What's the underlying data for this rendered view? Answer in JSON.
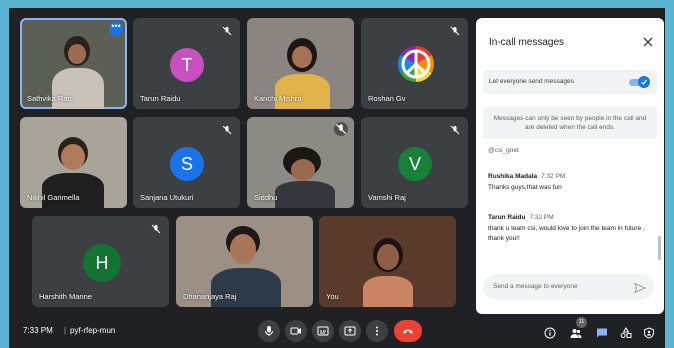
{
  "participants": [
    {
      "name": "Sathvika Rao",
      "type": "video"
    },
    {
      "name": "Tarun Raidu",
      "type": "avatar",
      "initial": "T",
      "color": "#c850c0"
    },
    {
      "name": "Kanchi Mishra",
      "type": "video"
    },
    {
      "name": "Roshan Gv",
      "type": "avatar-image"
    },
    {
      "name": "Nikhil Garimella",
      "type": "video"
    },
    {
      "name": "Sanjana Utukuri",
      "type": "avatar",
      "initial": "S",
      "color": "#1a73e8"
    },
    {
      "name": "Siddhu",
      "type": "video"
    },
    {
      "name": "Vamshi Raj",
      "type": "avatar",
      "initial": "V",
      "color": "#188038"
    },
    {
      "name": "Harshith Manne",
      "type": "avatar",
      "initial": "H",
      "color": "#137333"
    },
    {
      "name": "Dhananjaya Raj",
      "type": "video"
    },
    {
      "name": "You",
      "type": "video"
    }
  ],
  "panel": {
    "title": "In-call messages",
    "toggle_label": "Let everyone send messages",
    "notice": "Messages can only be seen by people in the call and are deleted when the call ends.",
    "partial_text": "@csi_gnet",
    "messages": [
      {
        "sender": "Rushika Madala",
        "time": "7:32 PM",
        "text": "Thanks guys,that was fun"
      },
      {
        "sender": "Tarun Raidu",
        "time": "7:32 PM",
        "text": "thank u team csi, would love to join the team in future , thank you!!"
      }
    ],
    "compose_placeholder": "Send a message to everyone"
  },
  "bottom": {
    "time": "7:33 PM",
    "separator": "|",
    "meeting_code": "pyf-rfep-mun",
    "people_count": "11"
  },
  "colors": {
    "background": "#202124",
    "accent": "#1a73e8",
    "end_call": "#ea4335"
  }
}
